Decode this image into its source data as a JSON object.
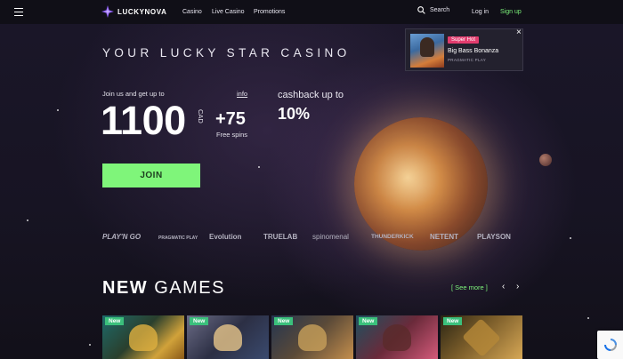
{
  "header": {
    "brand": "LUCKYNOVA",
    "nav": [
      "Casino",
      "Live Casino",
      "Promotions"
    ],
    "search_label": "Search",
    "login_label": "Log in",
    "signup_label": "Sign up"
  },
  "hero": {
    "tagline": "YOUR LUCKY STAR CASINO",
    "join_text": "Join us and get up to",
    "info_link": "info",
    "amount": "1100",
    "currency": "CAD",
    "spins": "+75",
    "spins_label": "Free spins",
    "cashback_label": "cashback up to",
    "cashback_value": "10%",
    "join_button": "JOIN"
  },
  "popup": {
    "badge": "Super Hot",
    "game": "Big Bass Bonanza",
    "provider": "PRAGMATIC PLAY",
    "close": "×"
  },
  "providers": [
    "PLAY'N GO",
    "PRAGMATIC PLAY",
    "Evolution",
    "TRUELAB",
    "spinomenal",
    "THUNDERKICK",
    "NETENT",
    "PLAYSON"
  ],
  "new_games": {
    "title_bold": "NEW",
    "title_rest": "GAMES",
    "see_more": "[ See more ]",
    "prev_icon": "‹",
    "next_icon": "›",
    "badge": "New",
    "cards": 5
  },
  "colors": {
    "accent": "#7ff57a",
    "header_bg": "#100f17",
    "hot_badge": "#e23c6e",
    "new_badge": "#3bc07c"
  }
}
